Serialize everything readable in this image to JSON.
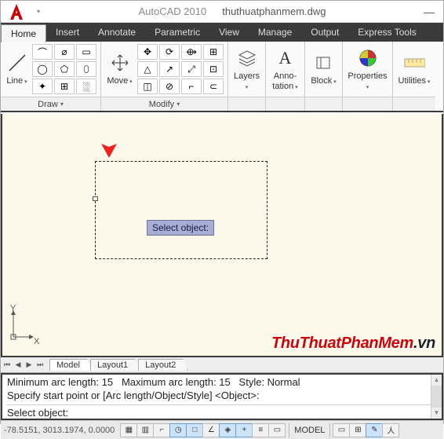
{
  "title": {
    "app": "AutoCAD 2010",
    "file": "thuthuatphanmem.dwg"
  },
  "tabs": [
    "Home",
    "Insert",
    "Annotate",
    "Parametric",
    "View",
    "Manage",
    "Output",
    "Express Tools"
  ],
  "active_tab": 0,
  "panels": {
    "draw": {
      "label": "Draw",
      "line": "Line"
    },
    "modify": {
      "label": "Modify",
      "move": "Move"
    },
    "layers": {
      "label": "Layers",
      "btn": "Layers"
    },
    "anno": {
      "label": "Anno-\ntation"
    },
    "block": {
      "label": "Block",
      "btn": "Block"
    },
    "props": {
      "label": "Properties"
    },
    "util": {
      "label": "Utilities"
    }
  },
  "icons": {
    "draw": [
      "⌒",
      "⌀",
      "▭",
      "◯",
      "⬠",
      "⬯",
      "✦",
      "⊞",
      "░"
    ],
    "modify_grid": [
      "✥",
      "⟳",
      "⟴",
      "⊞",
      "△",
      "↗",
      "⤢",
      "⊡",
      "◫",
      "⊘",
      "⌐",
      "⊂"
    ]
  },
  "tooltip": "Select object:",
  "layout_tabs": [
    "Model",
    "Layout1",
    "Layout2"
  ],
  "cmd": {
    "l1a": "Minimum arc length: 15",
    "l1b": "Maximum arc length: 15",
    "l1c": "Style: Normal",
    "l2": "Specify start point or [Arc length/Object/Style] <Object>:",
    "l3": "Select object:"
  },
  "status": {
    "coords": "-78.5151, 3013.1974, 0.0000",
    "mode": "MODEL"
  },
  "watermark": {
    "a": "ThuThuatPhanMem",
    "b": ".vn"
  }
}
